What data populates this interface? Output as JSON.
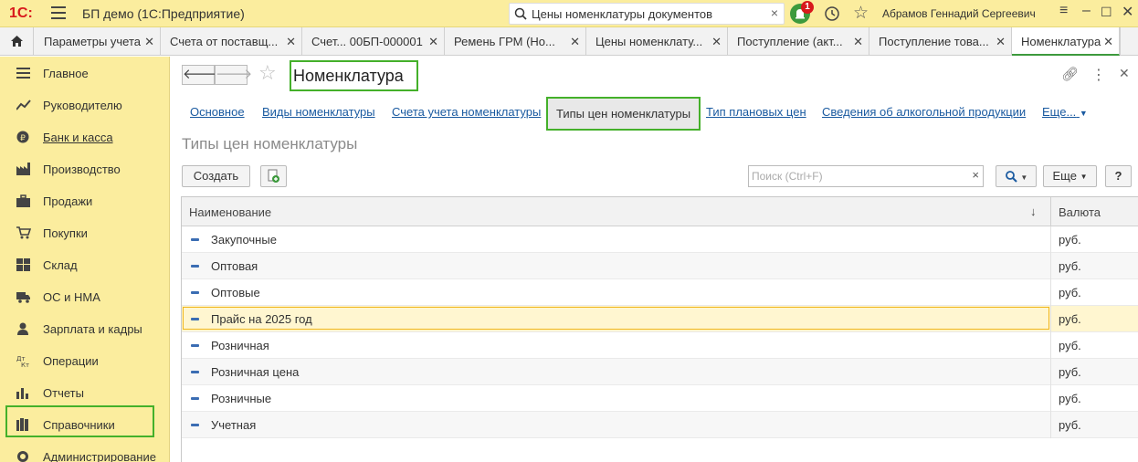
{
  "app": {
    "logo_text": "1С:",
    "title": "БП демо  (1С:Предприятие)",
    "search_value": "Цены номенклатуры документов",
    "notifications": "1",
    "user": "Абрамов Геннадий Сергеевич"
  },
  "tabs": [
    {
      "label": "Параметры учета"
    },
    {
      "label": "Счета от поставщ..."
    },
    {
      "label": "Счет... 00БП-000001"
    },
    {
      "label": "Ремень ГРМ (Но..."
    },
    {
      "label": "Цены номенклату..."
    },
    {
      "label": "Поступление (акт..."
    },
    {
      "label": "Поступление това..."
    },
    {
      "label": "Номенклатура",
      "active": true
    }
  ],
  "sidebar": {
    "items": [
      {
        "label": "Главное",
        "icon": "menu-lines-icon"
      },
      {
        "label": "Руководителю",
        "icon": "chart-trend-icon"
      },
      {
        "label": "Банк и касса",
        "icon": "ruble-coin-icon"
      },
      {
        "label": "Производство",
        "icon": "factory-icon"
      },
      {
        "label": "Продажи",
        "icon": "briefcase-icon"
      },
      {
        "label": "Покупки",
        "icon": "cart-icon"
      },
      {
        "label": "Склад",
        "icon": "warehouse-grid-icon"
      },
      {
        "label": "ОС и НМА",
        "icon": "truck-icon"
      },
      {
        "label": "Зарплата и кадры",
        "icon": "person-icon"
      },
      {
        "label": "Операции",
        "icon": "debit-credit-icon"
      },
      {
        "label": "Отчеты",
        "icon": "bar-chart-icon"
      },
      {
        "label": "Справочники",
        "icon": "books-icon"
      },
      {
        "label": "Администрирование",
        "icon": "gear-icon"
      }
    ]
  },
  "form": {
    "title": "Номенклатура",
    "subtabs": [
      {
        "label": "Основное"
      },
      {
        "label": "Виды номенклатуры"
      },
      {
        "label": "Счета учета номенклатуры"
      },
      {
        "label": "Типы цен номенклатуры",
        "current": true
      },
      {
        "label": "Тип плановых цен"
      },
      {
        "label": "Сведения об алкогольной продукции"
      },
      {
        "label": "Еще..."
      }
    ],
    "section_title": "Типы цен номенклатуры",
    "create_label": "Создать",
    "search_placeholder": "Поиск (Ctrl+F)",
    "more_label": "Еще",
    "help_label": "?"
  },
  "table": {
    "columns": [
      "Наименование",
      "Валюта"
    ],
    "rows": [
      {
        "name": "Закупочные",
        "currency": "руб."
      },
      {
        "name": "Оптовая",
        "currency": "руб."
      },
      {
        "name": "Оптовые",
        "currency": "руб."
      },
      {
        "name": "Прайс на 2025 год",
        "currency": "руб.",
        "selected": true
      },
      {
        "name": "Розничная",
        "currency": "руб."
      },
      {
        "name": "Розничная цена",
        "currency": "руб."
      },
      {
        "name": "Розничные",
        "currency": "руб."
      },
      {
        "name": "Учетная",
        "currency": "руб."
      }
    ]
  },
  "colors": {
    "header_yellow": "#fbed9e",
    "highlight_green": "#44b02a",
    "link_blue": "#1a5aa0",
    "selection_orange": "#f0b61d"
  }
}
